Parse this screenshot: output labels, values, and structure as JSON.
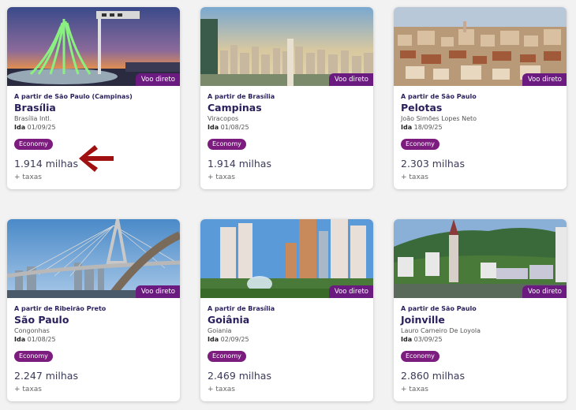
{
  "top_links": [
    "",
    ""
  ],
  "badge_label": "Voo direto",
  "cabin_label": "Economy",
  "taxes_label": "+ taxas",
  "date_prefix": "Ida",
  "colors": {
    "accent": "#6b1a80",
    "title": "#2a1f5c",
    "arrow": "#a01010"
  },
  "cards": [
    {
      "origin": "A partir de São Paulo (Campinas)",
      "city": "Brasília",
      "airport": "Brasília Intl.",
      "date": "01/09/25",
      "miles": "1.914 milhas",
      "image": "brasilia-cathedral"
    },
    {
      "origin": "A partir de Brasília",
      "city": "Campinas",
      "airport": "Viracopos",
      "date": "01/08/25",
      "miles": "1.914 milhas",
      "image": "campinas-skyline"
    },
    {
      "origin": "A partir de São Paulo",
      "city": "Pelotas",
      "airport": "João Simões Lopes Neto",
      "date": "18/09/25",
      "miles": "2.303 milhas",
      "image": "pelotas-rooftops"
    },
    {
      "origin": "A partir de Ribeirão Preto",
      "city": "São Paulo",
      "airport": "Congonhas",
      "date": "01/08/25",
      "miles": "2.247 milhas",
      "image": "sao-paulo-bridge"
    },
    {
      "origin": "A partir de Brasília",
      "city": "Goiânia",
      "airport": "Goiania",
      "date": "02/09/25",
      "miles": "2.469 milhas",
      "image": "goiania-towers"
    },
    {
      "origin": "A partir de São Paulo",
      "city": "Joinville",
      "airport": "Lauro Carneiro De Loyola",
      "date": "03/09/25",
      "miles": "2.860 milhas",
      "image": "joinville-church"
    }
  ]
}
